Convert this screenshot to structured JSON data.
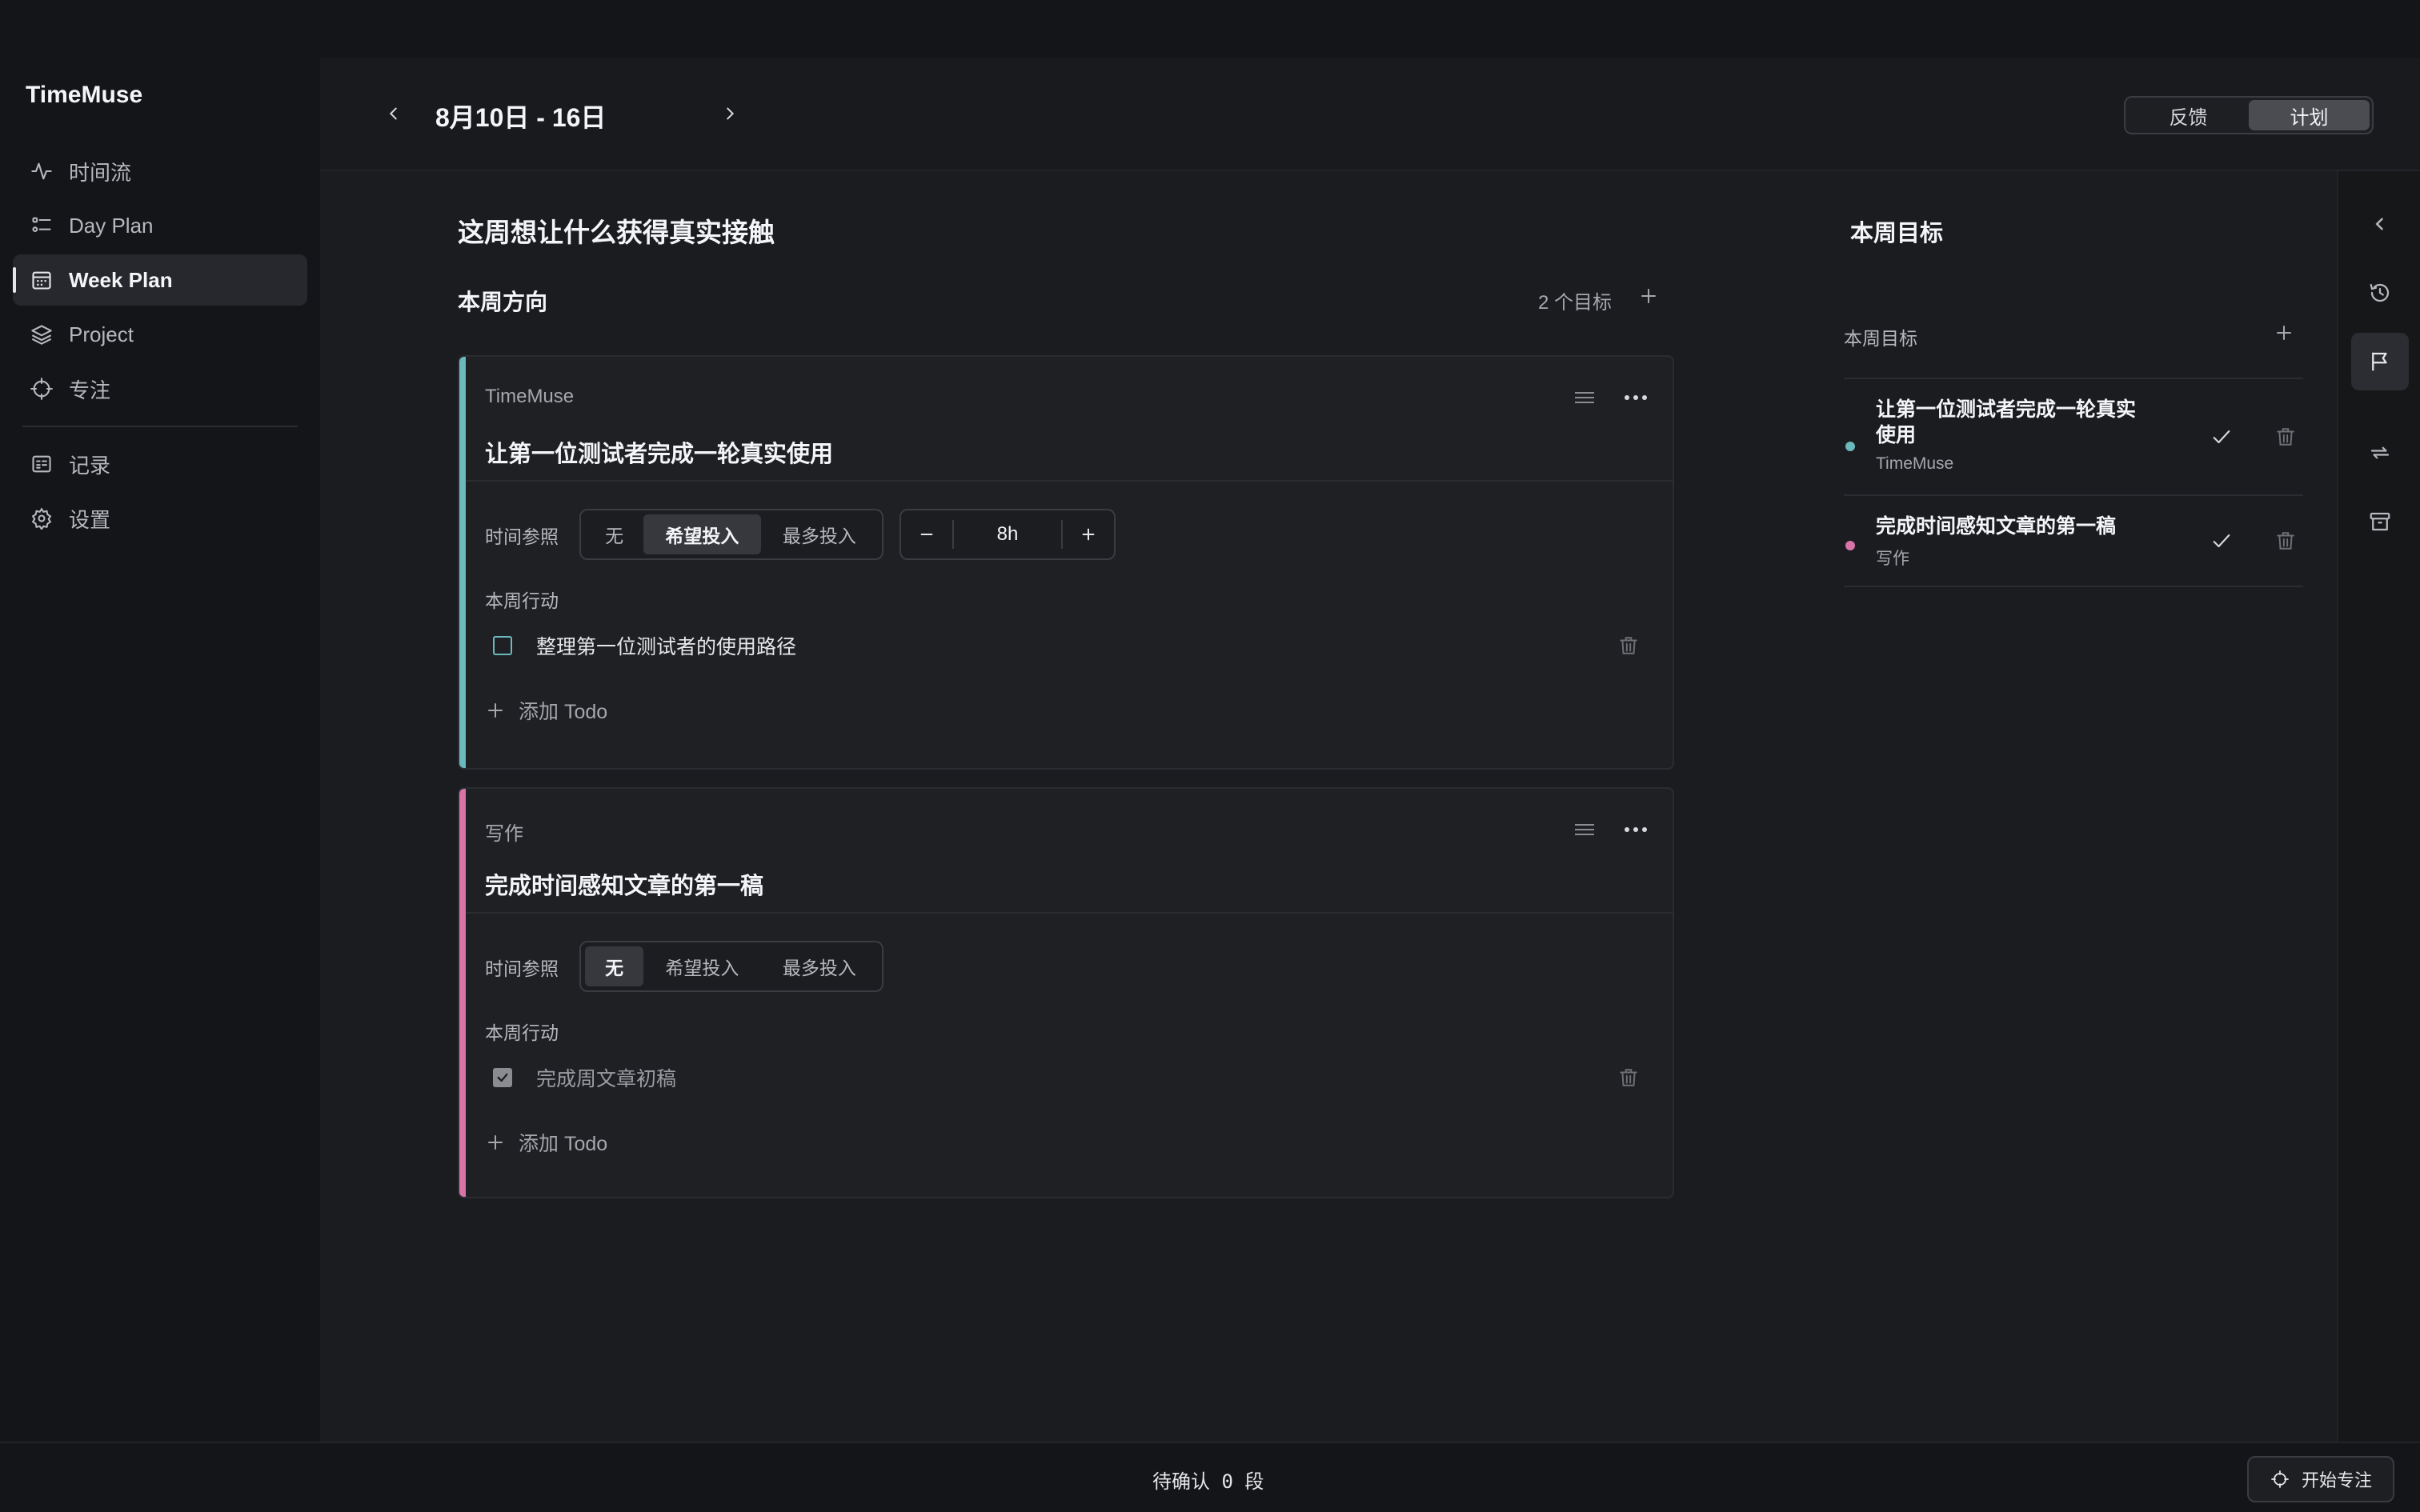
{
  "app": {
    "title": "TimeMuse"
  },
  "sidebar": {
    "items": [
      {
        "label": "时间流",
        "icon": "activity-icon"
      },
      {
        "label": "Day Plan",
        "icon": "list-icon"
      },
      {
        "label": "Week Plan",
        "icon": "calendar-icon",
        "active": true
      },
      {
        "label": "Project",
        "icon": "layers-icon"
      },
      {
        "label": "专注",
        "icon": "crosshair-icon"
      }
    ],
    "items2": [
      {
        "label": "记录",
        "icon": "notebook-icon"
      },
      {
        "label": "设置",
        "icon": "gear-icon"
      }
    ]
  },
  "header": {
    "date_range": "8月10日 - 16日",
    "toggle": {
      "feedback": "反馈",
      "plan": "计划",
      "selected": "计划"
    }
  },
  "main": {
    "heading": "这周想让什么获得真实接触",
    "direction_title": "本周方向",
    "goal_count": "2 个目标",
    "cards": [
      {
        "project": "TimeMuse",
        "title": "让第一位测试者完成一轮真实使用",
        "accent": "#6bb9bd",
        "time_label": "时间参照",
        "options": [
          "无",
          "希望投入",
          "最多投入"
        ],
        "selected": "希望投入",
        "hours": "8h",
        "actions_label": "本周行动",
        "todos": [
          {
            "text": "整理第一位测试者的使用路径",
            "done": false
          }
        ],
        "add_todo": "添加 Todo"
      },
      {
        "project": "写作",
        "title": "完成时间感知文章的第一稿",
        "accent": "#d873a8",
        "time_label": "时间参照",
        "options": [
          "无",
          "希望投入",
          "最多投入"
        ],
        "selected": "无",
        "actions_label": "本周行动",
        "todos": [
          {
            "text": "完成周文章初稿",
            "done": true
          }
        ],
        "add_todo": "添加 Todo"
      }
    ]
  },
  "right_panel": {
    "title": "本周目标",
    "section_label": "本周目标",
    "goals": [
      {
        "line1": "让第一位测试者完成一轮真实",
        "line2": "使用",
        "project": "TimeMuse",
        "color": "#6bb9bd"
      },
      {
        "line1": "完成时间感知文章的第一稿",
        "project": "写作",
        "color": "#d873a8"
      }
    ]
  },
  "status": {
    "pending": "待确认 0 段",
    "focus_button": "开始专注"
  },
  "colors": {
    "accent_teal": "#6bb9bd",
    "accent_pink": "#d873a8",
    "background": "#1b1c20"
  }
}
